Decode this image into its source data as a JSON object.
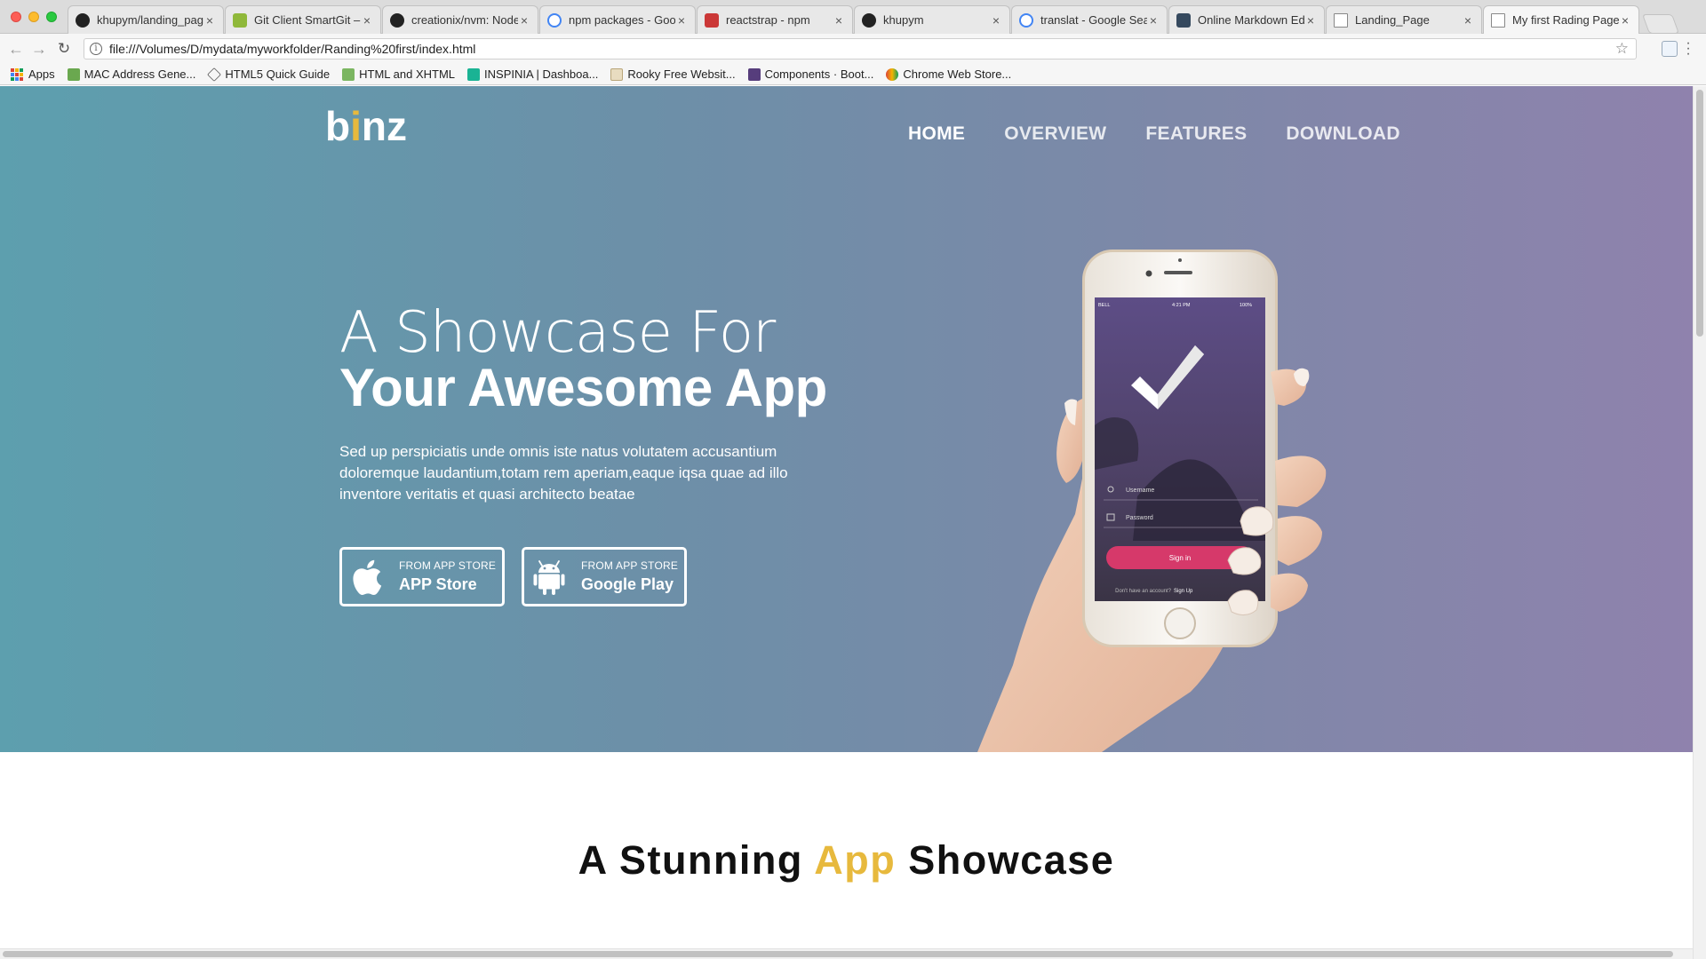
{
  "browser": {
    "tabs": [
      {
        "label": "khupym/landing_pag",
        "icon": "github-icon",
        "active": false
      },
      {
        "label": "Git Client SmartGit – \\",
        "icon": "smartgit-icon",
        "active": false
      },
      {
        "label": "creationix/nvm: Node",
        "icon": "github-icon",
        "active": false
      },
      {
        "label": "npm packages - Goo",
        "icon": "google-icon",
        "active": false
      },
      {
        "label": "reactstrap - npm",
        "icon": "npm-icon",
        "active": false
      },
      {
        "label": "khupym",
        "icon": "github-icon",
        "active": false
      },
      {
        "label": "translat - Google Sea",
        "icon": "google-icon",
        "active": false
      },
      {
        "label": "Online Markdown Edi",
        "icon": "dillinger-icon",
        "active": false
      },
      {
        "label": "Landing_Page",
        "icon": "document-icon",
        "active": false
      },
      {
        "label": "My first Rading Page",
        "icon": "document-icon",
        "active": true
      }
    ],
    "tab_close": "×",
    "url": "file:///Volumes/D/mydata/myworkfolder/Randing%20first/index.html",
    "info_glyph": "i",
    "bookmarks": [
      {
        "label": "Apps",
        "icon": "apps-grid-icon"
      },
      {
        "label": "MAC Address Gene...",
        "icon": "mac-address-icon"
      },
      {
        "label": "HTML5 Quick Guide",
        "icon": "html5-guide-icon"
      },
      {
        "label": "HTML and XHTML",
        "icon": "html-xhtml-icon"
      },
      {
        "label": "INSPINIA | Dashboa...",
        "icon": "inspinia-icon"
      },
      {
        "label": "Rooky Free Websit...",
        "icon": "rooky-icon"
      },
      {
        "label": "Components · Boot...",
        "icon": "bootstrap-icon"
      },
      {
        "label": "Chrome Web Store...",
        "icon": "chrome-webstore-icon"
      }
    ]
  },
  "page": {
    "logo": {
      "pre": "b",
      "dot": "i",
      "post": "nz"
    },
    "nav": [
      {
        "label": "HOME",
        "active": true
      },
      {
        "label": "OVERVIEW",
        "active": false
      },
      {
        "label": "FEATURES",
        "active": false
      },
      {
        "label": "DOWNLOAD",
        "active": false
      }
    ],
    "headline_light": "A Showcase For",
    "headline_bold": "Your Awesome App",
    "lede": "Sed up perspiciatis unde omnis iste natus volutatem accusantium doloremque laudantium,totam rem aperiam,eaque iqsa quae ad illo inventore veritatis et quasi architecto beatae",
    "buttons": [
      {
        "small": "FROM APP STORE",
        "big": "APP Store",
        "icon": "apple-icon"
      },
      {
        "small": "FROM APP STORE",
        "big": "Google Play",
        "icon": "android-icon"
      }
    ],
    "phone": {
      "carrier": "BELL",
      "time": "4:21 PM",
      "battery": "100%",
      "username_placeholder": "Username",
      "password_placeholder": "Password",
      "signin_label": "Sign in",
      "signup_prompt": "Don't have an account?",
      "signup_link": "Sign Up"
    },
    "section_title": {
      "pre": "A Stunning ",
      "accent": "App",
      "post": " Showcase"
    },
    "colors": {
      "accent": "#e7b93d",
      "signin": "#d6396a"
    }
  }
}
